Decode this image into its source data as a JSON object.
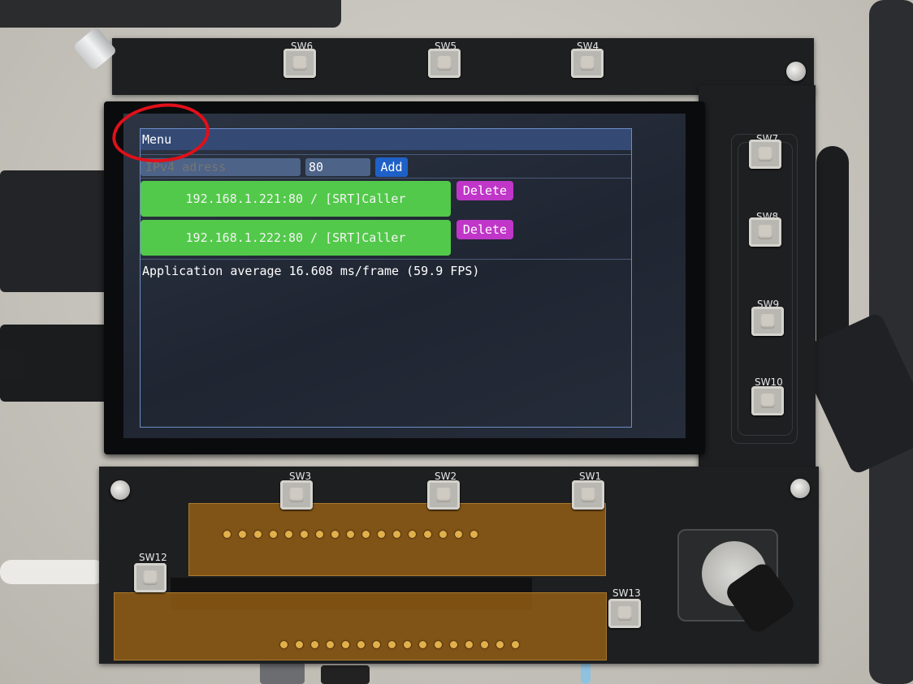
{
  "screen": {
    "window_title": "Menu",
    "ip_placeholder": "IPv4 adress",
    "port_value": "80",
    "add_label": "Add",
    "connections": [
      {
        "label": "192.168.1.221:80 / [SRT]Caller",
        "delete_label": "Delete"
      },
      {
        "label": "192.168.1.222:80 / [SRT]Caller",
        "delete_label": "Delete"
      }
    ],
    "status_text": "Application average 16.608 ms/frame (59.9 FPS)"
  },
  "board": {
    "switch_labels": {
      "sw1": "SW1",
      "sw2": "SW2",
      "sw3": "SW3",
      "sw4": "SW4",
      "sw5": "SW5",
      "sw6": "SW6",
      "sw7": "SW7",
      "sw8": "SW8",
      "sw9": "SW9",
      "sw10": "SW10",
      "sw12": "SW12",
      "sw13": "SW13"
    }
  },
  "colors": {
    "titlebar": "#344a75",
    "connection_button": "#52c94a",
    "delete_button": "#c036c8",
    "add_button": "#1e60c7",
    "annotation_circle": "#e0101a"
  }
}
